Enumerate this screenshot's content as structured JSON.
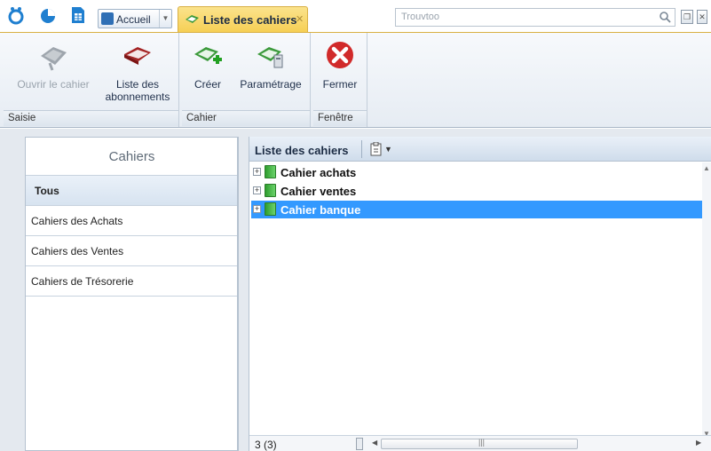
{
  "titlebar": {
    "home_tab_label": "Accueil",
    "active_tab_label": "Liste des cahiers",
    "search_placeholder": "Trouvtoo"
  },
  "ribbon": {
    "groups": [
      {
        "caption": "Saisie",
        "buttons": [
          "Ouvrir le cahier",
          "Liste des abonnements"
        ]
      },
      {
        "caption": "Cahier",
        "buttons": [
          "Créer",
          "Paramétrage"
        ]
      },
      {
        "caption": "Fenêtre",
        "buttons": [
          "Fermer"
        ]
      }
    ],
    "btn_open_line1": "Ouvrir le cahier",
    "btn_subs_line1": "Liste des",
    "btn_subs_line2": "abonnements"
  },
  "left_panel": {
    "title": "Cahiers",
    "categories": [
      "Tous",
      "Cahiers des Achats",
      "Cahiers des Ventes",
      "Cahiers de Trésorerie"
    ],
    "selected_index": 0
  },
  "right_panel": {
    "title": "Liste des cahiers",
    "rows": [
      "Cahier achats",
      "Cahier ventes",
      "Cahier banque"
    ],
    "selected_row": 2,
    "status_count": "3 (3)"
  },
  "colors": {
    "active_tab": "#f6cf55",
    "selection": "#3399ff",
    "book_green": "#2f9e2f"
  }
}
